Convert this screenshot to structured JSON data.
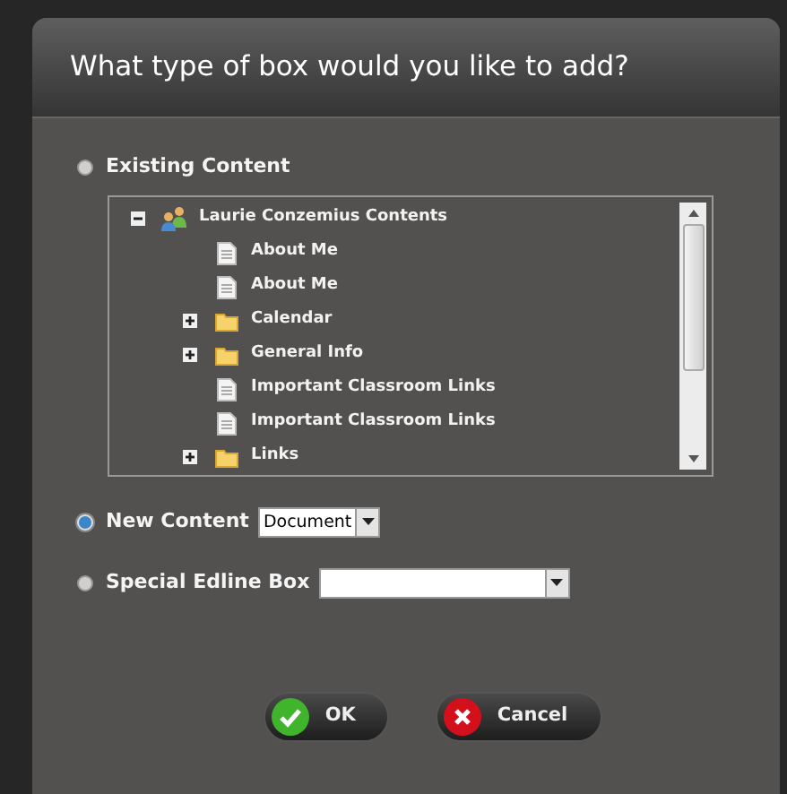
{
  "dialog": {
    "title": "What type of box would you like to add?"
  },
  "options": [
    {
      "kind": "tree",
      "label": "Existing Content",
      "selected": false,
      "tree": [
        {
          "label": "Laurie Conzemius Contents",
          "kind": "people",
          "expanded": true,
          "children": [
            {
              "label": "About Me",
              "kind": "document"
            },
            {
              "label": "About Me",
              "kind": "document"
            },
            {
              "label": "Calendar",
              "kind": "folder",
              "expanded": false
            },
            {
              "label": "General Info",
              "kind": "folder",
              "expanded": false
            },
            {
              "label": "Important Classroom Links",
              "kind": "document"
            },
            {
              "label": "Important Classroom Links",
              "kind": "document"
            },
            {
              "label": "Links",
              "kind": "folder",
              "expanded": false
            }
          ]
        }
      ]
    },
    {
      "kind": "select",
      "label": "New Content",
      "selected": true,
      "value": "Document"
    },
    {
      "kind": "select",
      "label": "Special Edline Box",
      "selected": false
    }
  ],
  "buttons": [
    {
      "kind": "ok",
      "label": "OK"
    },
    {
      "kind": "cancel",
      "label": "Cancel"
    }
  ]
}
